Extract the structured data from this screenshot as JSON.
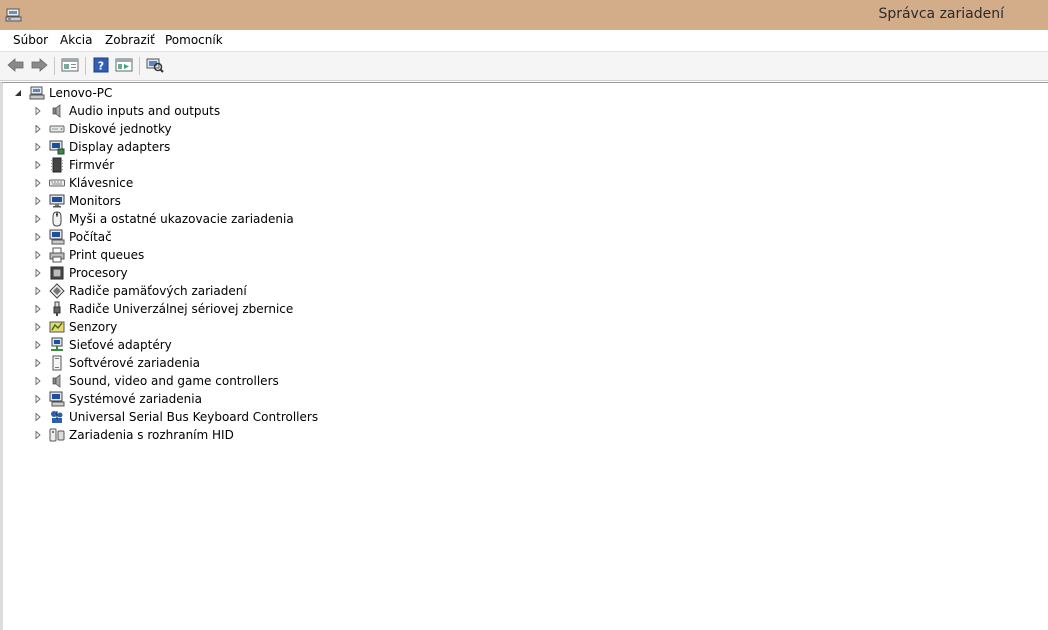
{
  "window": {
    "title": "Správca zariadení"
  },
  "menu": {
    "items": [
      {
        "label": "Súbor"
      },
      {
        "label": "Akcia"
      },
      {
        "label": "Zobraziť"
      },
      {
        "label": "Pomocník"
      }
    ]
  },
  "toolbar": {
    "buttons": [
      {
        "icon": "back-arrow-icon"
      },
      {
        "icon": "forward-arrow-icon"
      },
      {
        "icon": "properties-icon"
      },
      {
        "icon": "help-icon"
      },
      {
        "icon": "view-icon"
      },
      {
        "icon": "scan-hardware-icon"
      }
    ]
  },
  "tree": {
    "root": {
      "label": "Lenovo-PC",
      "icon": "computer-icon",
      "expanded": true
    },
    "items": [
      {
        "label": "Audio inputs and outputs",
        "icon": "speaker-icon"
      },
      {
        "label": "Diskové jednotky",
        "icon": "disk-drive-icon"
      },
      {
        "label": "Display adapters",
        "icon": "display-adapter-icon"
      },
      {
        "label": "Firmvér",
        "icon": "firmware-icon"
      },
      {
        "label": "Klávesnice",
        "icon": "keyboard-icon"
      },
      {
        "label": "Monitors",
        "icon": "monitor-icon"
      },
      {
        "label": "Myši a ostatné ukazovacie zariadenia",
        "icon": "mouse-icon"
      },
      {
        "label": "Počítač",
        "icon": "computer-icon"
      },
      {
        "label": "Print queues",
        "icon": "printer-icon"
      },
      {
        "label": "Procesory",
        "icon": "processor-icon"
      },
      {
        "label": "Radiče pamäťových zariadení",
        "icon": "storage-controller-icon"
      },
      {
        "label": "Radiče Univerzálnej sériovej zbernice",
        "icon": "usb-icon"
      },
      {
        "label": "Senzory",
        "icon": "sensor-icon"
      },
      {
        "label": "Sieťové adaptéry",
        "icon": "network-adapter-icon"
      },
      {
        "label": "Softvérové zariadenia",
        "icon": "software-device-icon"
      },
      {
        "label": "Sound, video and game controllers",
        "icon": "speaker-icon"
      },
      {
        "label": "Systémové zariadenia",
        "icon": "system-device-icon"
      },
      {
        "label": "Universal Serial Bus Keyboard Controllers",
        "icon": "usb-keyboard-controller-icon"
      },
      {
        "label": "Zariadenia s rozhraním HID",
        "icon": "hid-device-icon"
      }
    ]
  }
}
